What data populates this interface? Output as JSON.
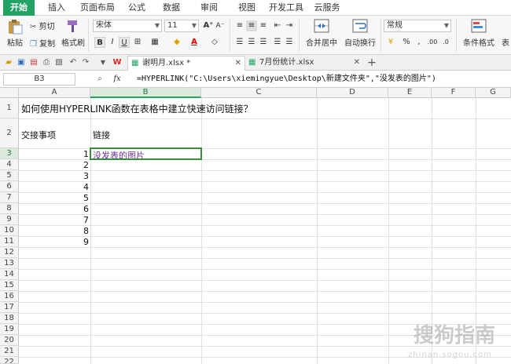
{
  "menu": {
    "tabs": [
      "开始",
      "插入",
      "页面布局",
      "公式",
      "数据",
      "审阅",
      "视图",
      "开发工具",
      "云服务"
    ],
    "active_tab": 0
  },
  "ribbon": {
    "paste": "粘贴",
    "cut": "剪切",
    "copy": "复制",
    "format_painter": "格式刷",
    "font_name": "宋体",
    "font_size": "11",
    "bold": "B",
    "italic": "I",
    "underline": "U",
    "merge_center": "合并居中",
    "wrap_text": "自动换行",
    "number_format": "常规",
    "percent": "%",
    "thousands": ",",
    "decimal_add": ".00",
    "decimal_remove": ".0",
    "conditional_format": "条件格式",
    "more": "表"
  },
  "doc_tabs": [
    {
      "label": "谢明月.xlsx *",
      "active": true
    },
    {
      "label": "7月份统计.xlsx",
      "active": false
    }
  ],
  "formula_bar": {
    "cell_ref": "B3",
    "fx": "fx",
    "formula": "=HYPERLINK(\"C:\\Users\\xiemingyue\\Desktop\\新建文件夹\",\"没发表的图片\")"
  },
  "sheet": {
    "columns": [
      "A",
      "B",
      "C",
      "D",
      "E",
      "F",
      "G"
    ],
    "rows": [
      "1",
      "2",
      "3",
      "4",
      "5",
      "6",
      "7",
      "8",
      "9",
      "10",
      "11",
      "12",
      "13",
      "14",
      "15",
      "16",
      "17",
      "18",
      "19",
      "20",
      "21",
      "22"
    ],
    "title": "如何使用HYPERLINK函数在表格中建立快速访问链接？",
    "header_a": "交接事项",
    "header_b": "链接",
    "col_a_values": [
      "1",
      "2",
      "3",
      "4",
      "5",
      "6",
      "7",
      "8",
      "9"
    ],
    "b3_link": "没发表的图片"
  },
  "watermark": {
    "text": "搜狗指南",
    "url": "zhinan.sogou.com"
  },
  "colors": {
    "accent": "#21a366",
    "link": "#7030a0"
  }
}
